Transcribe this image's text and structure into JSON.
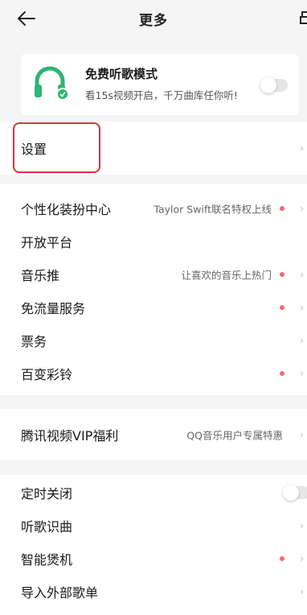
{
  "header": {
    "title": "更多",
    "back_icon": "arrow-left-icon",
    "right_icon": "partial-icon"
  },
  "promo": {
    "title": "免费听歌模式",
    "subtitle": "看15s视频开启，千万曲库任你听!",
    "icon": "headphones-icon",
    "icon_color": "#2bb673",
    "toggle_on": false
  },
  "settings": {
    "label": "设置",
    "chevron": "›"
  },
  "group1": [
    {
      "label": "个性化装扮中心",
      "sub": "Taylor Swift联名特权上线",
      "dot": true,
      "chevron": "›"
    },
    {
      "label": "开放平台",
      "sub": "",
      "dot": false,
      "chevron": ""
    },
    {
      "label": "音乐推",
      "sub": "让喜欢的音乐上热门",
      "dot": true,
      "chevron": "›"
    },
    {
      "label": "免流量服务",
      "sub": "",
      "dot": true,
      "chevron": "›"
    },
    {
      "label": "票务",
      "sub": "",
      "dot": false,
      "chevron": "›"
    },
    {
      "label": "百变彩铃",
      "sub": "",
      "dot": true,
      "chevron": "›"
    }
  ],
  "group2": [
    {
      "label": "腾讯视频VIP福利",
      "sub": "QQ音乐用户专属特惠",
      "dot": false,
      "chevron": "›"
    }
  ],
  "group3": {
    "timer": {
      "label": "定时关闭",
      "toggle_on": false
    },
    "items": [
      {
        "label": "听歌识曲",
        "dot": false,
        "chevron": "›"
      },
      {
        "label": "智能煲机",
        "dot": true,
        "chevron": "›"
      },
      {
        "label": "导入外部歌单",
        "dot": false,
        "chevron": "›"
      }
    ]
  },
  "colors": {
    "accent_dot": "#f06a78",
    "highlight_border": "#d9343f",
    "background": "#f5f5f5"
  }
}
